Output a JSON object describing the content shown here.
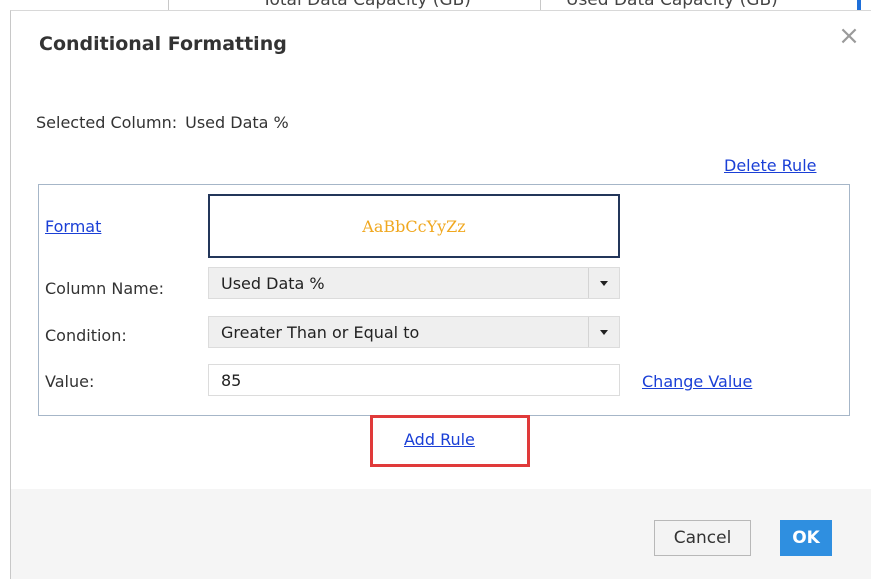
{
  "background": {
    "header_left": "Total Data Capacity (GB)",
    "header_right": "Used Data Capacity (GB)"
  },
  "dialog": {
    "title": "Conditional Formatting",
    "close_icon": "close-icon"
  },
  "selected_column": {
    "label": "Selected Column:",
    "value": "Used Data %"
  },
  "rule": {
    "delete_label": "Delete Rule",
    "format_label": "Format",
    "preview_text": "AaBbCcYyZz",
    "preview_color": "#f0a820",
    "column_name_label": "Column Name:",
    "column_name_value": "Used Data %",
    "condition_label": "Condition:",
    "condition_value": "Greater Than or Equal to",
    "value_label": "Value:",
    "value": "85",
    "change_value_label": "Change Value"
  },
  "add_rule_label": "Add Rule",
  "highlight_color": "#e03a3a",
  "buttons": {
    "cancel": "Cancel",
    "ok": "OK",
    "ok_color": "#2f8fe0"
  },
  "link_color": "#1a3fd6"
}
